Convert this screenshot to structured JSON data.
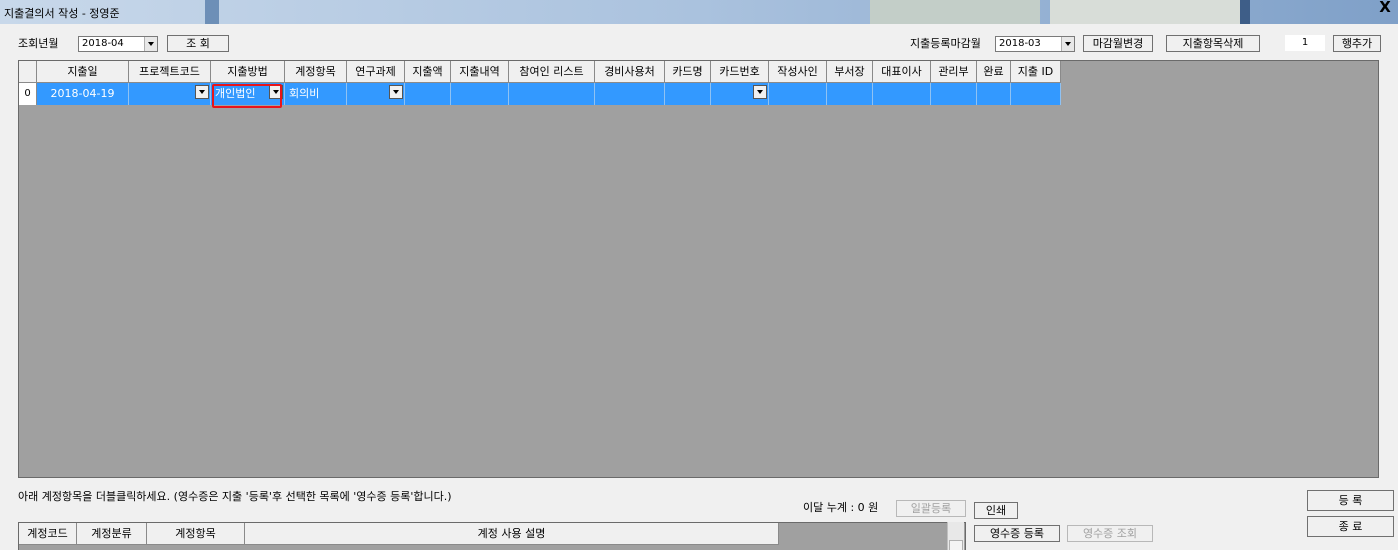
{
  "window": {
    "title": "지출결의서 작성 - 정영준",
    "close_glyph": "X"
  },
  "filter": {
    "month_label": "조회년월",
    "month_value": "2018-04",
    "search_button": "조 회"
  },
  "closing": {
    "label": "지출등록마감월",
    "month_value": "2018-03",
    "change_button": "마감월변경",
    "delete_button": "지출항목삭제",
    "row_count": "1",
    "add_row_button": "행추가"
  },
  "grid": {
    "columns": [
      "지출일",
      "프로젝트코드",
      "지출방법",
      "계정항목",
      "연구과제",
      "지출액",
      "지출내역",
      "참여인 리스트",
      "경비사용처",
      "카드명",
      "카드번호",
      "작성사인",
      "부서장",
      "대표이사",
      "관리부",
      "완료",
      "지출 ID"
    ],
    "rows": [
      {
        "index": "0",
        "cells": [
          "2018-04-19",
          "",
          "개인법인",
          "회의비",
          "",
          "",
          "",
          "",
          "",
          "",
          "",
          "",
          "",
          "",
          "",
          "",
          ""
        ]
      }
    ]
  },
  "instructions": "아래 계정항목을 더블클릭하세요. (영수증은 지출 '등록'후 선택한 목록에 '영수증 등록'합니다.)",
  "summary": {
    "monthly_total": "이달 누계 : 0 원"
  },
  "buttons": {
    "batch_register": "일괄등록",
    "print": "인쇄",
    "receipt_register": "영수증 등록",
    "receipt_lookup": "영수증 조회",
    "register": "등 록",
    "exit": "종 료"
  },
  "account_grid": {
    "columns": [
      "계정코드",
      "계정분류",
      "계정항목",
      "계정 사용 설명"
    ]
  },
  "colors": {
    "selection": "#3399ff",
    "grid_background": "#a0a0a0",
    "highlight_box": "#e8141a"
  }
}
